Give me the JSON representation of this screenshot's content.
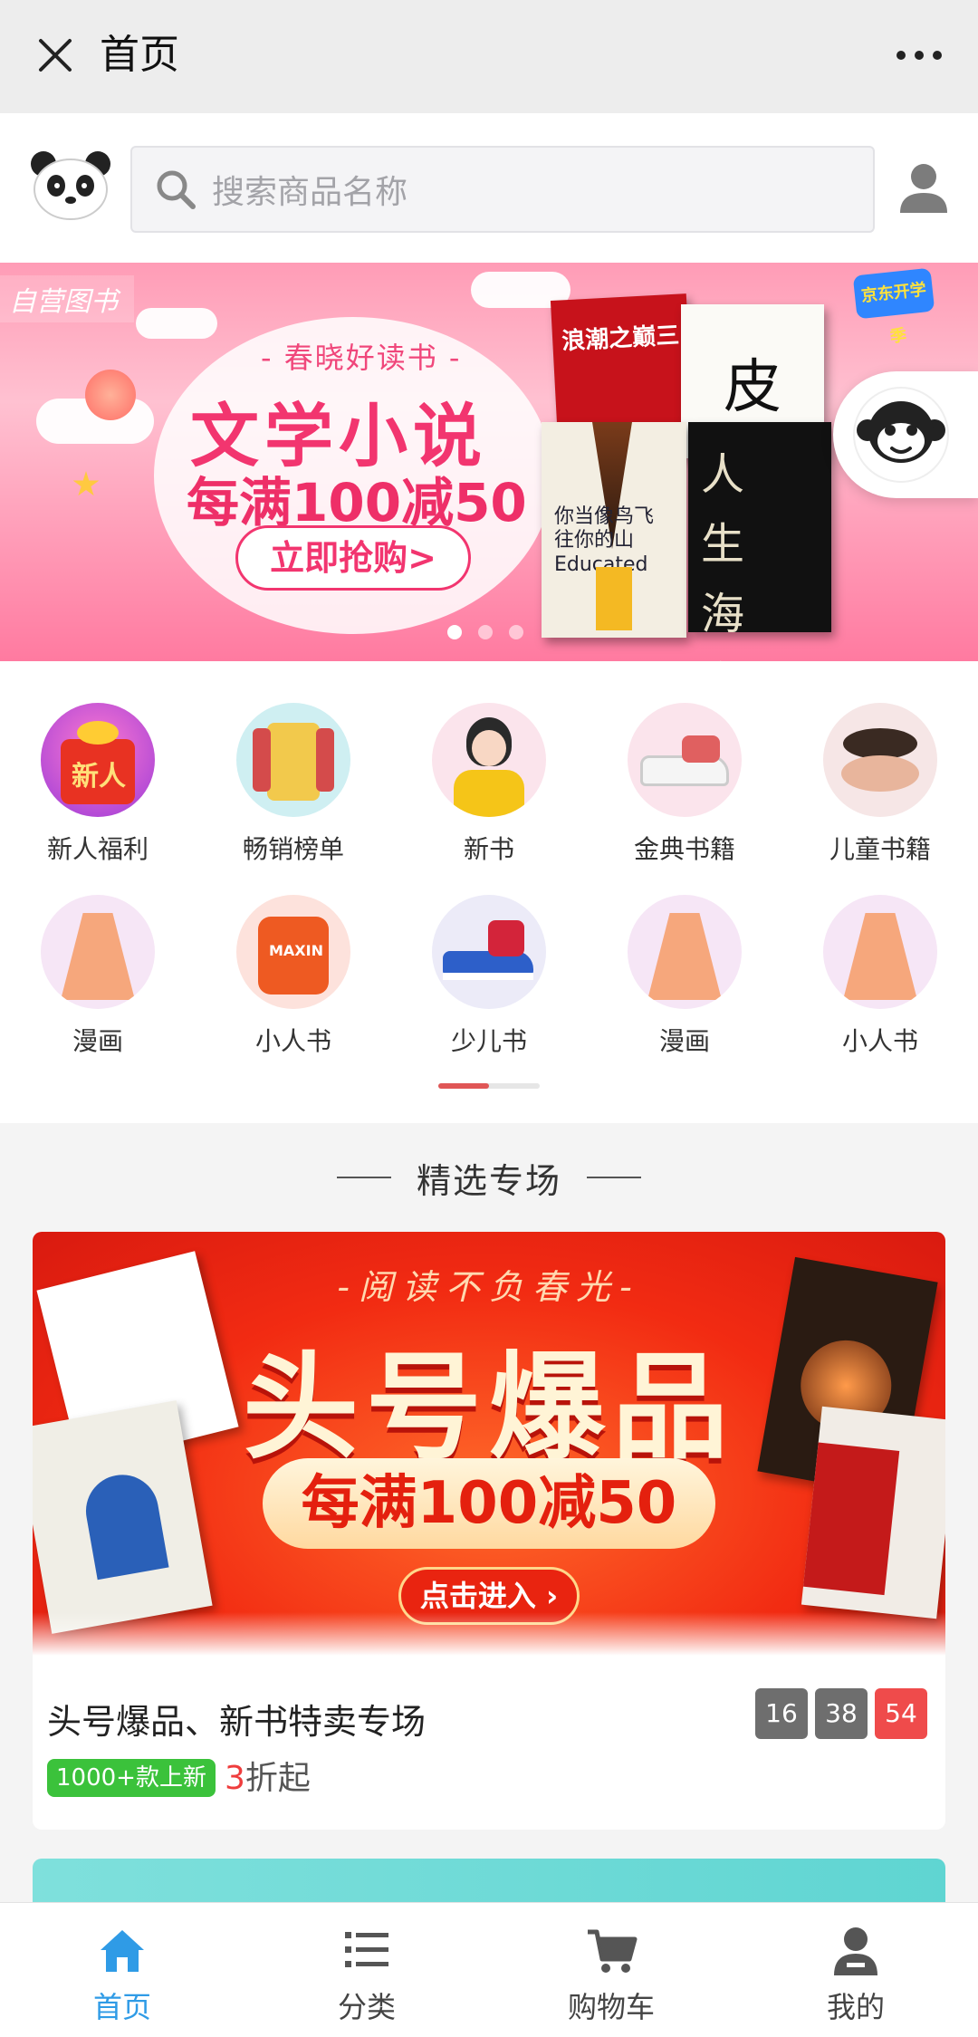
{
  "titlebar": {
    "title": "首页"
  },
  "search": {
    "placeholder": "搜索商品名称"
  },
  "banner": {
    "tag": "自营图书",
    "subtitle": "- 春晓好读书 -",
    "headline": "文学小说",
    "deal": "每满100减50",
    "cta": "立即抢购>",
    "corner_badge": "京东开学季",
    "books": [
      "浪潮之巅三",
      "皮",
      "你当像鸟飞往你的山 Educated",
      "人生海海"
    ],
    "slide_index": 1,
    "slide_count": 3
  },
  "categories": {
    "row1": [
      {
        "label": "新人福利",
        "icon": "gift-new-icon"
      },
      {
        "label": "畅销榜单",
        "icon": "sweater-icon"
      },
      {
        "label": "新书",
        "icon": "girl-avatar-icon"
      },
      {
        "label": "金典书籍",
        "icon": "sneaker-icon"
      },
      {
        "label": "儿童书籍",
        "icon": "cushion-compact-icon"
      }
    ],
    "row2": [
      {
        "label": "漫画",
        "icon": "skirt-icon"
      },
      {
        "label": "小人书",
        "icon": "sweatshirt-icon"
      },
      {
        "label": "少儿书",
        "icon": "shoe-icon"
      },
      {
        "label": "漫画",
        "icon": "skirt-icon"
      },
      {
        "label": "小人书",
        "icon": "skirt-icon"
      }
    ],
    "page": 1,
    "pages": 2
  },
  "section": {
    "title": "精选专场"
  },
  "featured": {
    "slogan": "-阅读不负春光-",
    "headline": "头号爆品",
    "deal": "每满100减50",
    "enter": "点击进入 ›",
    "title": "头号爆品、新书特卖专场",
    "timer": {
      "h": "16",
      "m": "38",
      "s": "54"
    },
    "new_tag": "1000+款上新",
    "discount_num": "3",
    "discount_suffix": "折起"
  },
  "tabbar": {
    "tabs": [
      {
        "label": "首页",
        "active": true
      },
      {
        "label": "分类",
        "active": false
      },
      {
        "label": "购物车",
        "active": false
      },
      {
        "label": "我的",
        "active": false
      }
    ]
  },
  "colors": {
    "accent": "#2f9be6",
    "sale_red": "#ef3d3d",
    "new_green": "#3bc23b",
    "banner_pink": "#ff7aa0"
  }
}
